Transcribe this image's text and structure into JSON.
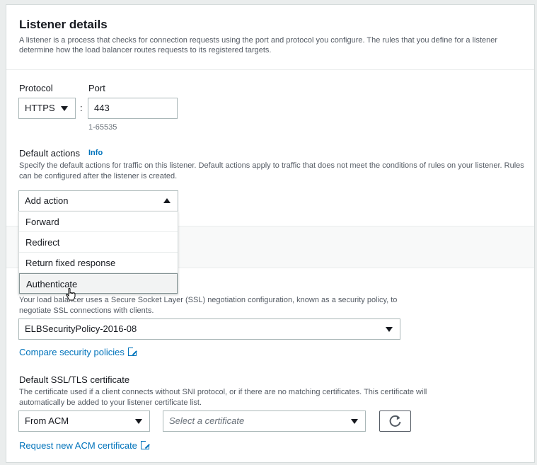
{
  "section": {
    "title": "Listener details",
    "description": "A listener is a process that checks for connection requests using the port and protocol you configure. The rules that you define for a listener determine how the load balancer routes requests to its registered targets."
  },
  "protocol": {
    "label": "Protocol",
    "value": "HTTPS"
  },
  "separator": ":",
  "port": {
    "label": "Port",
    "value": "443",
    "hint": "1-65535"
  },
  "default_actions": {
    "label": "Default actions",
    "info": "Info",
    "help": "Specify the default actions for traffic on this listener. Default actions apply to traffic that does not meet the conditions of rules on your listener. Rules can be configured after the listener is created.",
    "select_label": "Add action",
    "options": [
      "Forward",
      "Redirect",
      "Return fixed response",
      "Authenticate"
    ]
  },
  "security_policy": {
    "help": "Your load balancer uses a Secure Socket Layer (SSL) negotiation configuration, known as a security policy, to negotiate SSL connections with clients.",
    "value": "ELBSecurityPolicy-2016-08",
    "compare_link": "Compare security policies"
  },
  "certificate": {
    "label": "Default SSL/TLS certificate",
    "help": "The certificate used if a client connects without SNI protocol, or if there are no matching certificates. This certificate will automatically be added to your listener certificate list.",
    "source": "From ACM",
    "placeholder": "Select a certificate",
    "request_link": "Request new ACM certificate"
  },
  "icons": {
    "external": "external-link-icon",
    "refresh": "refresh-icon",
    "caret": "caret-down-icon",
    "cursor": "hand-cursor-icon"
  },
  "colors": {
    "link": "#0073bb",
    "text": "#16191f",
    "border": "#aab7b8"
  }
}
